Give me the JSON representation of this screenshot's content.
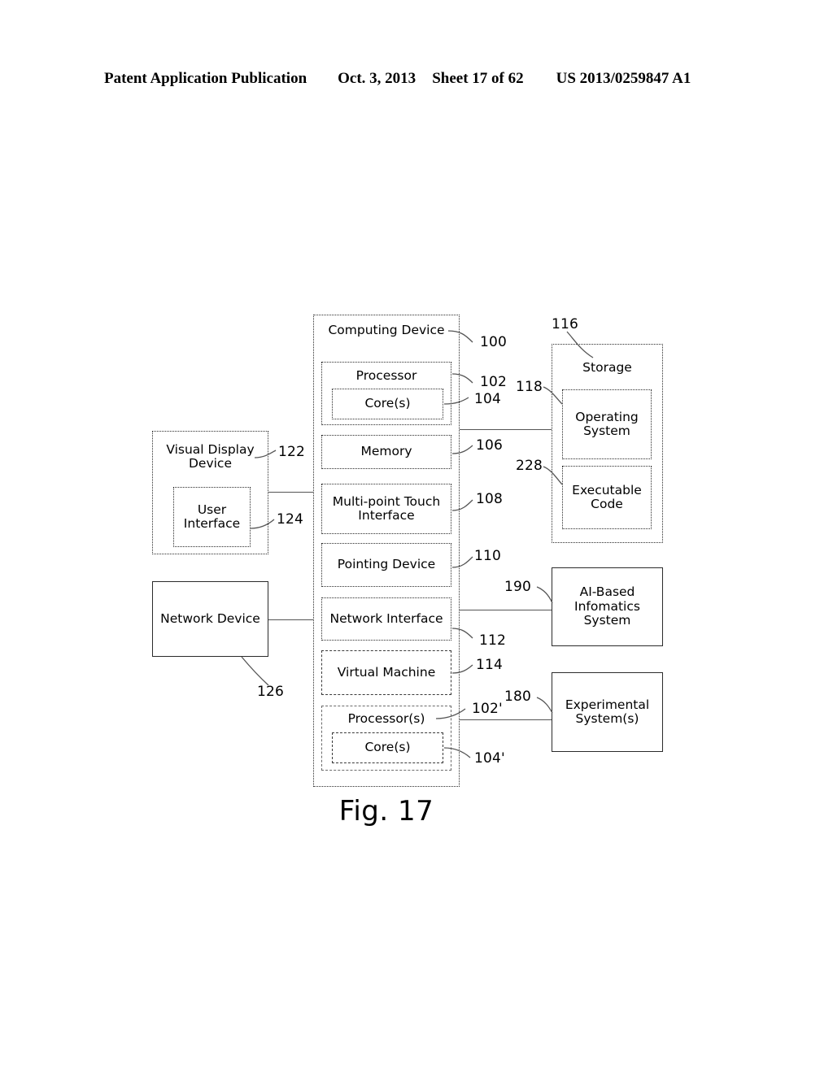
{
  "header": {
    "publication": "Patent Application Publication",
    "date": "Oct. 3, 2013",
    "sheet": "Sheet 17 of 62",
    "patent_number": "US 2013/0259847 A1"
  },
  "figure": {
    "caption": "Fig. 17"
  },
  "diagram": {
    "computing_device": {
      "label": "Computing Device",
      "ref": "100",
      "children": {
        "processor": {
          "label": "Processor",
          "ref": "102"
        },
        "cores": {
          "label": "Core(s)",
          "ref": "104"
        },
        "memory": {
          "label": "Memory",
          "ref": "106"
        },
        "touch_interface": {
          "label": "Multi-point Touch Interface",
          "ref": "108"
        },
        "pointing_device": {
          "label": "Pointing Device",
          "ref": "110"
        },
        "network_interface": {
          "label": "Network Interface",
          "ref": "112"
        },
        "virtual_machine": {
          "label": "Virtual Machine",
          "ref": "114"
        },
        "vm_processors": {
          "label": "Processor(s)",
          "ref": "102'"
        },
        "vm_cores": {
          "label": "Core(s)",
          "ref": "104'"
        }
      }
    },
    "storage": {
      "label": "Storage",
      "ref": "116",
      "children": {
        "operating_system": {
          "label": "Operating System",
          "ref": "118"
        },
        "executable_code": {
          "label": "Executable Code",
          "ref": "228"
        }
      }
    },
    "ai_system": {
      "label": "AI-Based Infomatics System",
      "ref": "190"
    },
    "experimental_system": {
      "label": "Experimental System(s)",
      "ref": "180"
    },
    "visual_display_device": {
      "label": "Visual Display Device",
      "ref": "122",
      "children": {
        "user_interface": {
          "label": "User Interface",
          "ref": "124"
        }
      }
    },
    "network_device": {
      "label": "Network Device",
      "ref": "126"
    }
  }
}
